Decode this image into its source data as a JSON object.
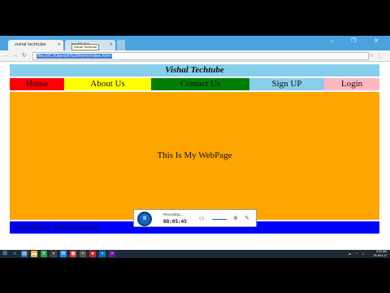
{
  "browser": {
    "tabs": [
      {
        "label": "vishal techtube"
      },
      {
        "label": "techtube"
      }
    ],
    "address": "file:///C:/Users/h%20html/index.html",
    "tooltip": "Vishal Techtube",
    "window_controls": "– ❐ ✕"
  },
  "page": {
    "header": "Vishal Techtube",
    "nav": {
      "home": "Home",
      "about": "About Us",
      "contact": "Contact Us",
      "signup": "Sign UP",
      "login": "Login"
    },
    "main_text": "This Is My WebPage",
    "footer_text": "Copyright by Vishal techtube"
  },
  "recorder": {
    "status": "Recording...",
    "elapsed": "00:05:45"
  },
  "taskbar": {
    "time": "9:00 AM",
    "date": "26-Nov-17"
  },
  "colors": {
    "header_bg": "#87ceeb",
    "home_bg": "#ff0000",
    "about_bg": "#ffff00",
    "contact_bg": "#008000",
    "signup_bg": "#87ceeb",
    "login_bg": "#ffb6c1",
    "main_bg": "#ffa500",
    "footer_bg": "#0000ff"
  }
}
